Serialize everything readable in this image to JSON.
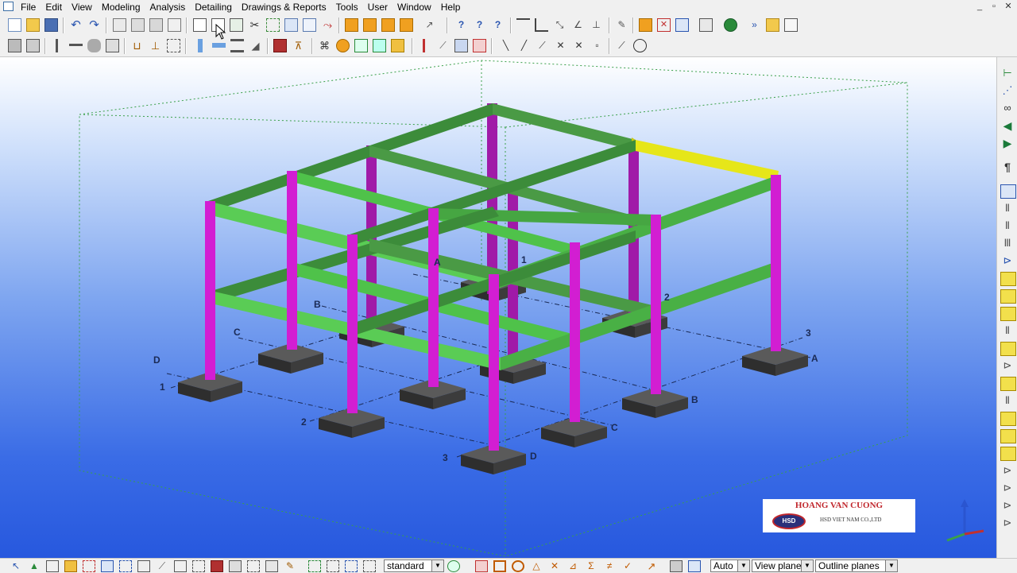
{
  "menu": {
    "items": [
      "File",
      "Edit",
      "View",
      "Modeling",
      "Analysis",
      "Detailing",
      "Drawings & Reports",
      "Tools",
      "User",
      "Window",
      "Help"
    ]
  },
  "window_controls": [
    "_",
    "▫",
    "✕"
  ],
  "grid_labels": {
    "front_numbers": [
      "1",
      "2",
      "3"
    ],
    "left_letters": [
      "D",
      "C",
      "B",
      "A"
    ],
    "right_letters": [
      "A",
      "B",
      "C",
      "D"
    ],
    "back_numbers": [
      "1",
      "2",
      "3"
    ]
  },
  "watermark": {
    "name": "HOANG VAN CUONG",
    "logo_text": "HSD",
    "company": "HSD VIET NAM CO.,LTD"
  },
  "statusbar": {
    "select_filter": "standard",
    "snap_mode": "Auto",
    "work_plane": "View plane",
    "planes": "Outline planes"
  },
  "colors": {
    "column": "#d21ed2",
    "beam": "#4fc24a",
    "beam_selected": "#e6e619",
    "footing": "#3a3a3a"
  }
}
